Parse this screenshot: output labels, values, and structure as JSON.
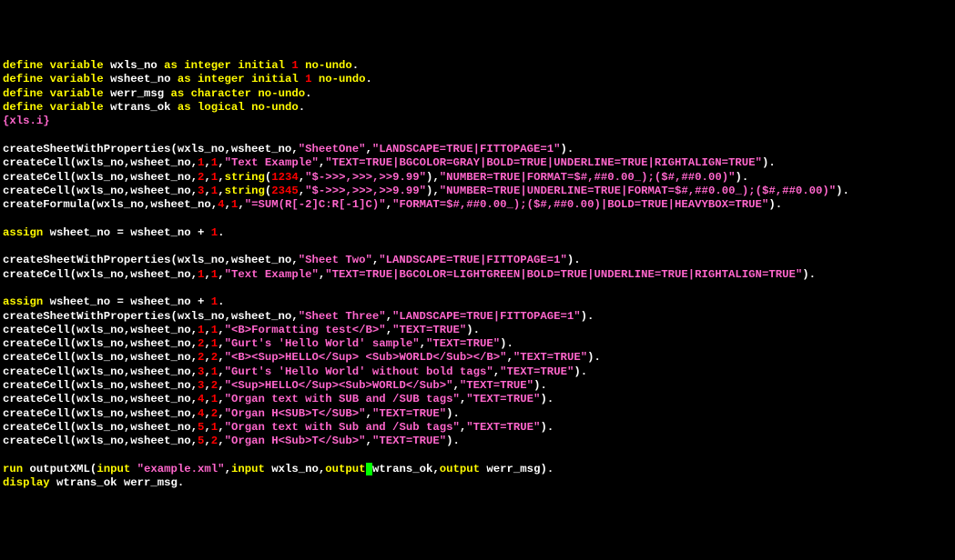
{
  "lines": [
    [
      [
        "define variable",
        "kw"
      ],
      [
        " wxls_no ",
        ""
      ],
      [
        "as integer initial",
        "kw"
      ],
      [
        " ",
        ""
      ],
      [
        "1",
        "num"
      ],
      [
        " ",
        ""
      ],
      [
        "no-undo",
        "kw"
      ],
      [
        ".",
        ""
      ]
    ],
    [
      [
        "define variable",
        "kw"
      ],
      [
        " wsheet_no ",
        ""
      ],
      [
        "as integer initial",
        "kw"
      ],
      [
        " ",
        ""
      ],
      [
        "1",
        "num"
      ],
      [
        " ",
        ""
      ],
      [
        "no-undo",
        "kw"
      ],
      [
        ".",
        ""
      ]
    ],
    [
      [
        "define variable",
        "kw"
      ],
      [
        " werr_msg ",
        ""
      ],
      [
        "as character no-undo",
        "kw"
      ],
      [
        ".",
        ""
      ]
    ],
    [
      [
        "define variable",
        "kw"
      ],
      [
        " wtrans_ok ",
        ""
      ],
      [
        "as logical no-undo",
        "kw"
      ],
      [
        ".",
        ""
      ]
    ],
    [
      [
        "{xls.i}",
        "str"
      ]
    ],
    [
      [
        " ",
        ""
      ]
    ],
    [
      [
        "createSheetWithProperties(wxls_no,wsheet_no,",
        ""
      ],
      [
        "\"SheetOne\"",
        "str"
      ],
      [
        ",",
        ""
      ],
      [
        "\"LANDSCAPE=TRUE|FITTOPAGE=1\"",
        "str"
      ],
      [
        ").",
        ""
      ]
    ],
    [
      [
        "createCell(wxls_no,wsheet_no,",
        ""
      ],
      [
        "1",
        "num"
      ],
      [
        ",",
        ""
      ],
      [
        "1",
        "num"
      ],
      [
        ",",
        ""
      ],
      [
        "\"Text Example\"",
        "str"
      ],
      [
        ",",
        ""
      ],
      [
        "\"TEXT=TRUE|BGCOLOR=GRAY|BOLD=TRUE|UNDERLINE=TRUE|RIGHTALIGN=TRUE\"",
        "str"
      ],
      [
        ").",
        ""
      ]
    ],
    [
      [
        "createCell(wxls_no,wsheet_no,",
        ""
      ],
      [
        "2",
        "num"
      ],
      [
        ",",
        ""
      ],
      [
        "1",
        "num"
      ],
      [
        ",",
        ""
      ],
      [
        "string",
        "kw"
      ],
      [
        "(",
        ""
      ],
      [
        "1234",
        "num"
      ],
      [
        ",",
        ""
      ],
      [
        "\"$->>>,>>>,>>9.99\"",
        "str"
      ],
      [
        "),",
        ""
      ],
      [
        "\"NUMBER=TRUE|FORMAT=$#,##0.00_);($#,##0.00)\"",
        "str"
      ],
      [
        ").",
        ""
      ]
    ],
    [
      [
        "createCell(wxls_no,wsheet_no,",
        ""
      ],
      [
        "3",
        "num"
      ],
      [
        ",",
        ""
      ],
      [
        "1",
        "num"
      ],
      [
        ",",
        ""
      ],
      [
        "string",
        "kw"
      ],
      [
        "(",
        ""
      ],
      [
        "2345",
        "num"
      ],
      [
        ",",
        ""
      ],
      [
        "\"$->>>,>>>,>>9.99\"",
        "str"
      ],
      [
        "),",
        ""
      ],
      [
        "\"NUMBER=TRUE|UNDERLINE=TRUE|FORMAT=$#,##0.00_);($#,##0.00)\"",
        "str"
      ],
      [
        ").",
        ""
      ]
    ],
    [
      [
        "createFormula(wxls_no,wsheet_no,",
        ""
      ],
      [
        "4",
        "num"
      ],
      [
        ",",
        ""
      ],
      [
        "1",
        "num"
      ],
      [
        ",",
        ""
      ],
      [
        "\"=SUM(R[-2]C:R[-1]C)\"",
        "str"
      ],
      [
        ",",
        ""
      ],
      [
        "\"FORMAT=$#,##0.00_);($#,##0.00)|BOLD=TRUE|HEAVYBOX=TRUE\"",
        "str"
      ],
      [
        ").",
        ""
      ]
    ],
    [
      [
        " ",
        ""
      ]
    ],
    [
      [
        "assign",
        "kw"
      ],
      [
        " wsheet_no = wsheet_no + ",
        ""
      ],
      [
        "1",
        "num"
      ],
      [
        ".",
        ""
      ]
    ],
    [
      [
        " ",
        ""
      ]
    ],
    [
      [
        "createSheetWithProperties(wxls_no,wsheet_no,",
        ""
      ],
      [
        "\"Sheet Two\"",
        "str"
      ],
      [
        ",",
        ""
      ],
      [
        "\"LANDSCAPE=TRUE|FITTOPAGE=1\"",
        "str"
      ],
      [
        ").",
        ""
      ]
    ],
    [
      [
        "createCell(wxls_no,wsheet_no,",
        ""
      ],
      [
        "1",
        "num"
      ],
      [
        ",",
        ""
      ],
      [
        "1",
        "num"
      ],
      [
        ",",
        ""
      ],
      [
        "\"Text Example\"",
        "str"
      ],
      [
        ",",
        ""
      ],
      [
        "\"TEXT=TRUE|BGCOLOR=LIGHTGREEN|BOLD=TRUE|UNDERLINE=TRUE|RIGHTALIGN=TRUE\"",
        "str"
      ],
      [
        ").",
        ""
      ]
    ],
    [
      [
        " ",
        ""
      ]
    ],
    [
      [
        "assign",
        "kw"
      ],
      [
        " wsheet_no = wsheet_no + ",
        ""
      ],
      [
        "1",
        "num"
      ],
      [
        ".",
        ""
      ]
    ],
    [
      [
        "createSheetWithProperties(wxls_no,wsheet_no,",
        ""
      ],
      [
        "\"Sheet Three\"",
        "str"
      ],
      [
        ",",
        ""
      ],
      [
        "\"LANDSCAPE=TRUE|FITTOPAGE=1\"",
        "str"
      ],
      [
        ").",
        ""
      ]
    ],
    [
      [
        "createCell(wxls_no,wsheet_no,",
        ""
      ],
      [
        "1",
        "num"
      ],
      [
        ",",
        ""
      ],
      [
        "1",
        "num"
      ],
      [
        ",",
        ""
      ],
      [
        "\"<B>Formatting test</B>\"",
        "str"
      ],
      [
        ",",
        ""
      ],
      [
        "\"TEXT=TRUE\"",
        "str"
      ],
      [
        ").",
        ""
      ]
    ],
    [
      [
        "createCell(wxls_no,wsheet_no,",
        ""
      ],
      [
        "2",
        "num"
      ],
      [
        ",",
        ""
      ],
      [
        "1",
        "num"
      ],
      [
        ",",
        ""
      ],
      [
        "\"Gurt's 'Hello World' sample\"",
        "str"
      ],
      [
        ",",
        ""
      ],
      [
        "\"TEXT=TRUE\"",
        "str"
      ],
      [
        ").",
        ""
      ]
    ],
    [
      [
        "createCell(wxls_no,wsheet_no,",
        ""
      ],
      [
        "2",
        "num"
      ],
      [
        ",",
        ""
      ],
      [
        "2",
        "num"
      ],
      [
        ",",
        ""
      ],
      [
        "\"<B><Sup>HELLO</Sup> <Sub>WORLD</Sub></B>\"",
        "str"
      ],
      [
        ",",
        ""
      ],
      [
        "\"TEXT=TRUE\"",
        "str"
      ],
      [
        ").",
        ""
      ]
    ],
    [
      [
        "createCell(wxls_no,wsheet_no,",
        ""
      ],
      [
        "3",
        "num"
      ],
      [
        ",",
        ""
      ],
      [
        "1",
        "num"
      ],
      [
        ",",
        ""
      ],
      [
        "\"Gurt's 'Hello World' without bold tags\"",
        "str"
      ],
      [
        ",",
        ""
      ],
      [
        "\"TEXT=TRUE\"",
        "str"
      ],
      [
        ").",
        ""
      ]
    ],
    [
      [
        "createCell(wxls_no,wsheet_no,",
        ""
      ],
      [
        "3",
        "num"
      ],
      [
        ",",
        ""
      ],
      [
        "2",
        "num"
      ],
      [
        ",",
        ""
      ],
      [
        "\"<Sup>HELLO</Sup><Sub>WORLD</Sub>\"",
        "str"
      ],
      [
        ",",
        ""
      ],
      [
        "\"TEXT=TRUE\"",
        "str"
      ],
      [
        ").",
        ""
      ]
    ],
    [
      [
        "createCell(wxls_no,wsheet_no,",
        ""
      ],
      [
        "4",
        "num"
      ],
      [
        ",",
        ""
      ],
      [
        "1",
        "num"
      ],
      [
        ",",
        ""
      ],
      [
        "\"Organ text with SUB and /SUB tags\"",
        "str"
      ],
      [
        ",",
        ""
      ],
      [
        "\"TEXT=TRUE\"",
        "str"
      ],
      [
        ").",
        ""
      ]
    ],
    [
      [
        "createCell(wxls_no,wsheet_no,",
        ""
      ],
      [
        "4",
        "num"
      ],
      [
        ",",
        ""
      ],
      [
        "2",
        "num"
      ],
      [
        ",",
        ""
      ],
      [
        "\"Organ H<SUB>T</SUB>\"",
        "str"
      ],
      [
        ",",
        ""
      ],
      [
        "\"TEXT=TRUE\"",
        "str"
      ],
      [
        ").",
        ""
      ]
    ],
    [
      [
        "createCell(wxls_no,wsheet_no,",
        ""
      ],
      [
        "5",
        "num"
      ],
      [
        ",",
        ""
      ],
      [
        "1",
        "num"
      ],
      [
        ",",
        ""
      ],
      [
        "\"Organ text with Sub and /Sub tags\"",
        "str"
      ],
      [
        ",",
        ""
      ],
      [
        "\"TEXT=TRUE\"",
        "str"
      ],
      [
        ").",
        ""
      ]
    ],
    [
      [
        "createCell(wxls_no,wsheet_no,",
        ""
      ],
      [
        "5",
        "num"
      ],
      [
        ",",
        ""
      ],
      [
        "2",
        "num"
      ],
      [
        ",",
        ""
      ],
      [
        "\"Organ H<Sub>T</Sub>\"",
        "str"
      ],
      [
        ",",
        ""
      ],
      [
        "\"TEXT=TRUE\"",
        "str"
      ],
      [
        ").",
        ""
      ]
    ],
    [
      [
        " ",
        ""
      ]
    ],
    [
      [
        "run",
        "kw"
      ],
      [
        " outputXML(",
        ""
      ],
      [
        "input",
        "kw"
      ],
      [
        " ",
        ""
      ],
      [
        "\"example.xml\"",
        "str"
      ],
      [
        ",",
        ""
      ],
      [
        "input",
        "kw"
      ],
      [
        " wxls_no,",
        ""
      ],
      [
        "output",
        "kw"
      ],
      [
        " ",
        "cur"
      ],
      [
        "wtrans_ok,",
        ""
      ],
      [
        "output",
        "kw"
      ],
      [
        " werr_msg).",
        ""
      ]
    ],
    [
      [
        "display",
        "kw"
      ],
      [
        " wtrans_ok werr_msg.",
        ""
      ]
    ]
  ]
}
